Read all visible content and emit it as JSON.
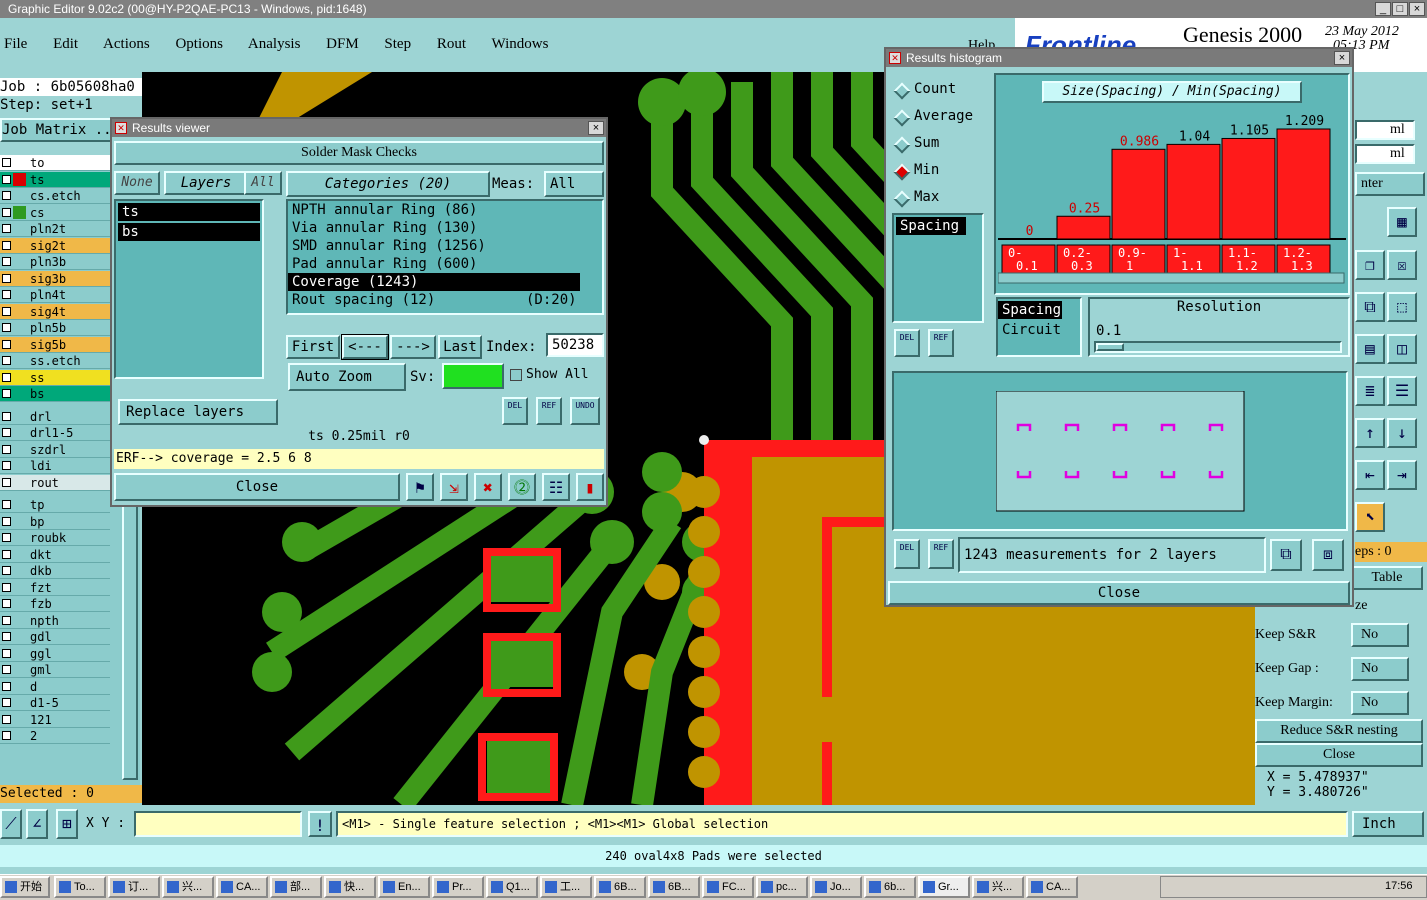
{
  "app": {
    "title": "Graphic Editor 9.02c2 (00@HY-P2QAE-PC13 - Windows, pid:1648)",
    "brand": "Genesis 2000",
    "brand_logo": "Frontline",
    "date": "23 May 2012",
    "time": "05:13 PM",
    "help": "Help"
  },
  "menu": [
    "File",
    "Edit",
    "Actions",
    "Options",
    "Analysis",
    "DFM",
    "Step",
    "Rout",
    "Windows"
  ],
  "job": {
    "job": "Job : 6b05608ha0",
    "step": "Step: set+1",
    "matrix": "Job Matrix ..."
  },
  "layers_top": [
    {
      "n": "to",
      "c": "#ffffff"
    },
    {
      "n": "ts",
      "c": "#00a87a",
      "sw": "#d80000"
    },
    {
      "n": "cs.etch",
      "c": "#8ccccc"
    },
    {
      "n": "cs",
      "c": "#8ccccc",
      "sw": "#2f9a20"
    },
    {
      "n": "pln2t",
      "c": "#8ccccc"
    },
    {
      "n": "sig2t",
      "c": "#f0b848"
    },
    {
      "n": "pln3b",
      "c": "#8ccccc"
    },
    {
      "n": "sig3b",
      "c": "#f0b848"
    },
    {
      "n": "pln4t",
      "c": "#8ccccc"
    },
    {
      "n": "sig4t",
      "c": "#f0b848"
    },
    {
      "n": "pln5b",
      "c": "#8ccccc"
    },
    {
      "n": "sig5b",
      "c": "#f0b848"
    },
    {
      "n": "ss.etch",
      "c": "#8ccccc"
    },
    {
      "n": "ss",
      "c": "#f0e020"
    },
    {
      "n": "bs",
      "c": "#00a87a"
    }
  ],
  "layers_mid": [
    "drl",
    "drl1-5",
    "szdrl",
    "ldi",
    "rout"
  ],
  "layers_bot": [
    "tp",
    "bp",
    "roubk",
    "dkt",
    "dkb",
    "fzt",
    "fzb",
    "npth",
    "gdl",
    "ggl",
    "gml",
    "d",
    "d1-5",
    "121",
    "2"
  ],
  "selected": "Selected : 0",
  "xy_label": "X Y :",
  "status_hint": "<M1> - Single feature selection ; <M1><M1> Global selection",
  "units": "Inch",
  "message": "240 oval4x8 Pads were selected",
  "results_viewer": {
    "title": "Results viewer",
    "heading": "Solder Mask Checks",
    "none": "None",
    "layers": "Layers",
    "all": "All",
    "categories": "Categories (20)",
    "meas_label": "Meas:",
    "meas_val": "All",
    "layer_items": [
      "ts",
      "bs"
    ],
    "cat_items": [
      "NPTH annular Ring (86)",
      "Via annular Ring (130)",
      "SMD annular Ring (1256)",
      "Pad annular Ring (600)",
      "Coverage (1243)",
      "Rout spacing (12)"
    ],
    "cat_extra": "(D:20)",
    "first": "First",
    "prev": "<---",
    "next": "--->",
    "last": "Last",
    "index_label": "Index:",
    "index": "50238",
    "auto_zoom": "Auto Zoom",
    "sv": "Sv:",
    "show_all": "Show All",
    "replace": "Replace layers",
    "del": "DEL",
    "ref": "REF",
    "undo": "UNDO",
    "info": "ts 0.25mil  r0",
    "erf": "ERF--> coverage = 2.5 6 8",
    "close": "Close"
  },
  "histogram": {
    "title": "Results histogram",
    "modes": [
      "Count",
      "Average",
      "Sum",
      "Min",
      "Max"
    ],
    "selected_mode": "Min",
    "chart_title": "Size(Spacing) / Min(Spacing)",
    "attr_items": [
      "Spacing"
    ],
    "attr2": [
      "Spacing",
      "Circuit"
    ],
    "resolution_label": "Resolution",
    "resolution": "0.1",
    "summary": "1243 measurements for 2 layers",
    "close": "Close",
    "del": "DEL",
    "ref": "REF"
  },
  "chart_data": {
    "type": "bar",
    "title": "Size(Spacing) / Min(Spacing)",
    "categories": [
      "0-0.1",
      "0.2-0.3",
      "0.9-1",
      "1-1.1",
      "1.1-1.2",
      "1.2-1.3"
    ],
    "values": [
      0,
      0.25,
      0.986,
      1.04,
      1.105,
      1.209
    ],
    "labels": [
      "0",
      "0.25",
      "0.986",
      "1.04",
      "1.105",
      "1.209"
    ]
  },
  "right_panel": {
    "ml1": "ml",
    "ml2": "ml",
    "center": "nter",
    "reps": "eps : 0",
    "table": "Table",
    "ze": "ze",
    "keep_sr": "Keep S&R",
    "keep_gap": "Keep Gap  :",
    "keep_margin": "Keep Margin:",
    "no": "No",
    "reduce": "Reduce S&R nesting",
    "close": "Close",
    "x": "X = 5.478937\"",
    "y": "Y = 3.480726\""
  },
  "taskbar": {
    "start": "开始",
    "items": [
      "To...",
      "订...",
      "兴...",
      "CA...",
      "部...",
      "快...",
      "En...",
      "Pr...",
      "Q1...",
      "工...",
      "6B...",
      "6B...",
      "FC...",
      "pc...",
      "Jo...",
      "6b...",
      "Gr...",
      "兴...",
      "CA..."
    ],
    "clock": "17:56"
  }
}
